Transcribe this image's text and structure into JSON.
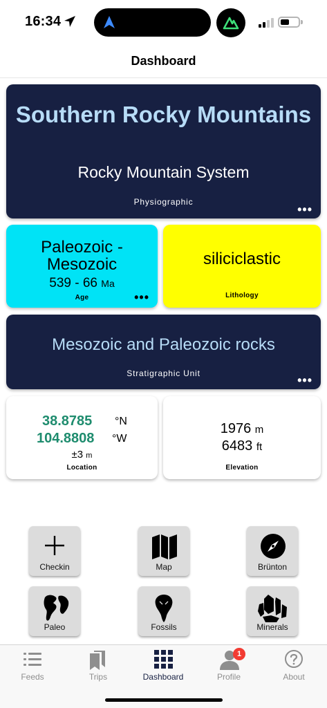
{
  "status_bar": {
    "time": "16:34"
  },
  "nav": {
    "title": "Dashboard"
  },
  "physiographic": {
    "name": "Southern Rocky Mountains",
    "system": "Rocky Mountain System",
    "label": "Physiographic",
    "more": "•••"
  },
  "age": {
    "name_line1": "Paleozoic -",
    "name_line2": "Mesozoic",
    "range": "539 - 66",
    "range_unit": "Ma",
    "label": "Age",
    "more": "•••"
  },
  "lithology": {
    "name": "siliciclastic",
    "label": "Lithology"
  },
  "stratigraphic": {
    "name": "Mesozoic and Paleozoic rocks",
    "label": "Stratigraphic Unit",
    "more": "•••"
  },
  "location": {
    "lat": "38.8785",
    "lat_unit": "°N",
    "lon": "104.8808",
    "lon_unit": "°W",
    "accuracy": "±3",
    "accuracy_unit": "m",
    "label": "Location"
  },
  "elevation": {
    "meters": "1976",
    "meters_unit": "m",
    "feet": "6483",
    "feet_unit": "ft",
    "label": "Elevation"
  },
  "tools": [
    {
      "label": "Checkin",
      "icon": "plus-icon"
    },
    {
      "label": "Map",
      "icon": "map-icon"
    },
    {
      "label": "Brünton",
      "icon": "compass-icon"
    },
    {
      "label": "Paleo",
      "icon": "continents-icon"
    },
    {
      "label": "Fossils",
      "icon": "fossil-icon"
    },
    {
      "label": "Minerals",
      "icon": "crystal-icon"
    }
  ],
  "tabs": [
    {
      "label": "Feeds",
      "icon": "list-icon"
    },
    {
      "label": "Trips",
      "icon": "bookmarks-icon"
    },
    {
      "label": "Dashboard",
      "icon": "grid-icon",
      "active": true
    },
    {
      "label": "Profile",
      "icon": "person-icon",
      "badge": "1"
    },
    {
      "label": "About",
      "icon": "question-icon"
    }
  ],
  "colors": {
    "navy": "#172042",
    "light_blue_text": "#b7dcf7",
    "age_cyan": "#00e3f6",
    "lithology_yellow": "#ffff00",
    "coordinate_green": "#1e8c6e",
    "badge_red": "#f23b32"
  }
}
